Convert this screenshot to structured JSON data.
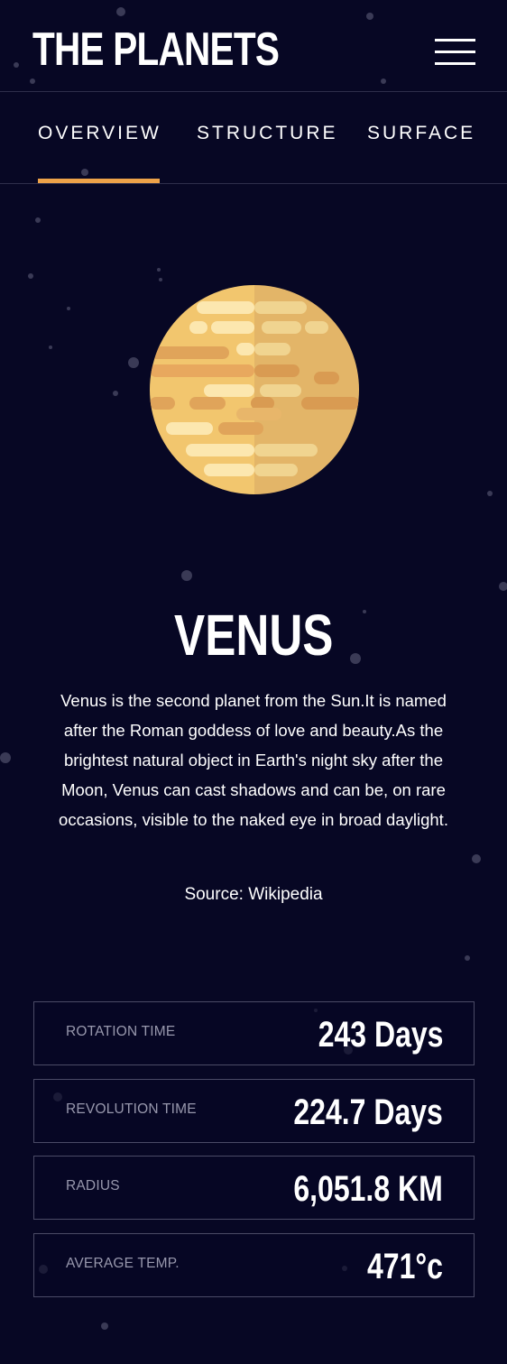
{
  "header": {
    "logo": "THE PLANETS",
    "menu_icon": "hamburger-menu-icon"
  },
  "tabs": [
    {
      "label": "OVERVIEW",
      "active": true
    },
    {
      "label": "STRUCTURE",
      "active": false
    },
    {
      "label": "SURFACE",
      "active": false
    }
  ],
  "planet": {
    "name": "VENUS",
    "description": "Venus is the second planet from the Sun.It is named after the Roman goddess of love and beauty.As the brightest natural object in Earth's night sky after the Moon, Venus can cast shadows and can be, on rare occasions, visible to the naked eye in broad daylight.",
    "source_label": "Source: Wikipedia",
    "image_icon": "venus-planet-icon"
  },
  "stats": [
    {
      "label": "ROTATION TIME",
      "value": "243 Days"
    },
    {
      "label": "REVOLUTION TIME",
      "value": "224.7 Days"
    },
    {
      "label": "RADIUS",
      "value": "6,051.8 KM"
    },
    {
      "label": "AVERAGE TEMP.",
      "value": "471°c"
    }
  ],
  "colors": {
    "background": "#070724",
    "accent": "#EDA249",
    "divider": "#2e2e4b",
    "stat_border": "#4b4b66",
    "planet_light": "#FCE7AF",
    "planet_mid": "#F2C66E",
    "planet_dark": "#E0A45A"
  }
}
